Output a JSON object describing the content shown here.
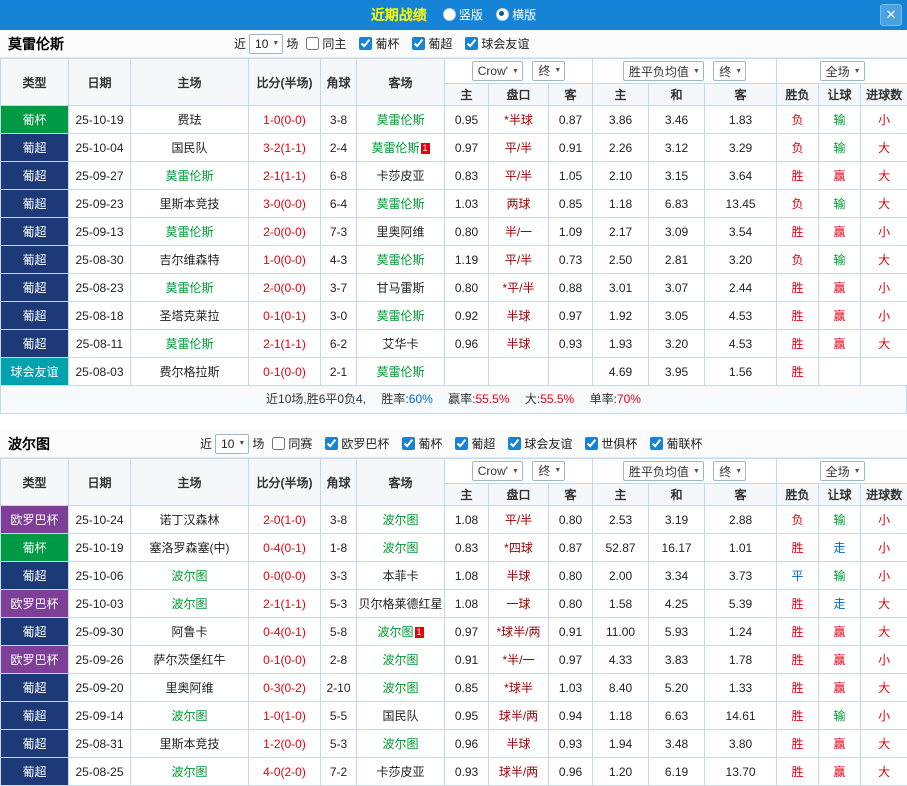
{
  "topbar": {
    "title": "近期战绩",
    "layout_options": [
      {
        "label": "竖版",
        "checked": false
      },
      {
        "label": "横版",
        "checked": true
      }
    ]
  },
  "icons": {
    "chevron_down": "▼",
    "close": "✕"
  },
  "colors": {
    "topbar_blue": "#1584d6",
    "title_yellow": "#ffff00",
    "cup_green": "#009a44",
    "liga_navy": "#1b3a77",
    "friendly_teal": "#00a2ad",
    "europa_purple": "#7d3f98",
    "score_red": "#e60012",
    "team_green": "#009933",
    "loss_green": "#009933",
    "win_red": "#e60012",
    "push_blue": "#0066cc"
  },
  "controls": {
    "near_label": "近",
    "count_value": "10",
    "matches_label": "场"
  },
  "header": {
    "type": "类型",
    "date": "日期",
    "home": "主场",
    "score": "比分(半场)",
    "corner": "角球",
    "away": "客场",
    "h_home": "主",
    "h_handicap": "盘口",
    "h_away": "客",
    "o_home": "主",
    "o_draw": "和",
    "o_away": "客",
    "res": "胜负",
    "let": "让球",
    "goals": "进球数",
    "bookmaker": "Crow'",
    "final1": "终",
    "avg": "胜平负均值",
    "final2": "终",
    "scope": "全场"
  },
  "sections": [
    {
      "team": "莫雷伦斯",
      "filters": [
        {
          "label": "同主",
          "checked": false
        },
        {
          "label": "葡杯",
          "checked": true
        },
        {
          "label": "葡超",
          "checked": true
        },
        {
          "label": "球会友谊",
          "checked": true
        }
      ],
      "rows": [
        {
          "type": "葡杯",
          "type_cls": "lg-cup",
          "date": "25-10-19",
          "home": "费珐",
          "score": "1-0(0-0)",
          "corner": "3-8",
          "away": "莫雷伦斯",
          "away_cls": "focus",
          "h_home": "0.95",
          "handicap": "*半球",
          "h_away": "0.87",
          "o_home": "3.86",
          "o_draw": "3.46",
          "o_away": "1.83",
          "res": "负",
          "res_cls": "t-red",
          "let": "输",
          "let_cls": "t-green",
          "goal": "小",
          "goal_cls": "t-red"
        },
        {
          "type": "葡超",
          "type_cls": "lg-liga",
          "date": "25-10-04",
          "home": "国民队",
          "score": "3-2(1-1)",
          "corner": "2-4",
          "away": "莫雷伦斯",
          "away_cls": "focus",
          "away_badge": "1",
          "h_home": "0.97",
          "handicap": "平/半",
          "h_away": "0.91",
          "o_home": "2.26",
          "o_draw": "3.12",
          "o_away": "3.29",
          "res": "负",
          "res_cls": "t-red",
          "let": "输",
          "let_cls": "t-green",
          "goal": "大",
          "goal_cls": "t-red"
        },
        {
          "type": "葡超",
          "type_cls": "lg-liga",
          "date": "25-09-27",
          "home": "莫雷伦斯",
          "home_cls": "focus",
          "score": "2-1(1-1)",
          "corner": "6-8",
          "away": "卡莎皮亚",
          "h_home": "0.83",
          "handicap": "平/半",
          "h_away": "1.05",
          "o_home": "2.10",
          "o_draw": "3.15",
          "o_away": "3.64",
          "res": "胜",
          "res_cls": "t-red",
          "let": "赢",
          "let_cls": "t-red",
          "goal": "大",
          "goal_cls": "t-red"
        },
        {
          "type": "葡超",
          "type_cls": "lg-liga",
          "date": "25-09-23",
          "home": "里斯本竞技",
          "score": "3-0(0-0)",
          "corner": "6-4",
          "away": "莫雷伦斯",
          "away_cls": "focus",
          "h_home": "1.03",
          "handicap": "两球",
          "h_away": "0.85",
          "o_home": "1.18",
          "o_draw": "6.83",
          "o_away": "13.45",
          "res": "负",
          "res_cls": "t-red",
          "let": "输",
          "let_cls": "t-green",
          "goal": "大",
          "goal_cls": "t-red"
        },
        {
          "type": "葡超",
          "type_cls": "lg-liga",
          "date": "25-09-13",
          "home": "莫雷伦斯",
          "home_cls": "focus",
          "score": "2-0(0-0)",
          "corner": "7-3",
          "away": "里奥阿维",
          "h_home": "0.80",
          "handicap": "半/一",
          "h_away": "1.09",
          "o_home": "2.17",
          "o_draw": "3.09",
          "o_away": "3.54",
          "res": "胜",
          "res_cls": "t-red",
          "let": "赢",
          "let_cls": "t-red",
          "goal": "小",
          "goal_cls": "t-red"
        },
        {
          "type": "葡超",
          "type_cls": "lg-liga",
          "date": "25-08-30",
          "home": "吉尔维森特",
          "score": "1-0(0-0)",
          "corner": "4-3",
          "away": "莫雷伦斯",
          "away_cls": "focus",
          "h_home": "1.19",
          "handicap": "平/半",
          "h_away": "0.73",
          "o_home": "2.50",
          "o_draw": "2.81",
          "o_away": "3.20",
          "res": "负",
          "res_cls": "t-red",
          "let": "输",
          "let_cls": "t-green",
          "goal": "大",
          "goal_cls": "t-red"
        },
        {
          "type": "葡超",
          "type_cls": "lg-liga",
          "date": "25-08-23",
          "home": "莫雷伦斯",
          "home_cls": "focus",
          "score": "2-0(0-0)",
          "corner": "3-7",
          "away": "甘马雷斯",
          "h_home": "0.80",
          "handicap": "*平/半",
          "h_away": "0.88",
          "o_home": "3.01",
          "o_draw": "3.07",
          "o_away": "2.44",
          "res": "胜",
          "res_cls": "t-red",
          "let": "赢",
          "let_cls": "t-red",
          "goal": "小",
          "goal_cls": "t-red"
        },
        {
          "type": "葡超",
          "type_cls": "lg-liga",
          "date": "25-08-18",
          "home": "圣塔克莱拉",
          "score": "0-1(0-1)",
          "corner": "3-0",
          "away": "莫雷伦斯",
          "away_cls": "focus",
          "h_home": "0.92",
          "handicap": "半球",
          "h_away": "0.97",
          "o_home": "1.92",
          "o_draw": "3.05",
          "o_away": "4.53",
          "res": "胜",
          "res_cls": "t-red",
          "let": "赢",
          "let_cls": "t-red",
          "goal": "小",
          "goal_cls": "t-red"
        },
        {
          "type": "葡超",
          "type_cls": "lg-liga",
          "date": "25-08-11",
          "home": "莫雷伦斯",
          "home_cls": "focus",
          "score": "2-1(1-1)",
          "corner": "6-2",
          "away": "艾华卡",
          "h_home": "0.96",
          "handicap": "半球",
          "h_away": "0.93",
          "o_home": "1.93",
          "o_draw": "3.20",
          "o_away": "4.53",
          "res": "胜",
          "res_cls": "t-red",
          "let": "赢",
          "let_cls": "t-red",
          "goal": "大",
          "goal_cls": "t-red"
        },
        {
          "type": "球会友谊",
          "type_cls": "lg-friendly",
          "date": "25-08-03",
          "home": "费尔格拉斯",
          "score": "0-1(0-0)",
          "corner": "2-1",
          "away": "莫雷伦斯",
          "away_cls": "focus",
          "h_home": "",
          "handicap": "",
          "h_away": "",
          "o_home": "4.69",
          "o_draw": "3.95",
          "o_away": "1.56",
          "res": "胜",
          "res_cls": "t-red",
          "let": "",
          "goal": ""
        }
      ],
      "summary": {
        "prefix": "近10场,胜6平0负4,",
        "stats": [
          {
            "label": "胜率:",
            "value": "60%",
            "cls": "t-blue"
          },
          {
            "label": "赢率:",
            "value": "55.5%",
            "cls": "t-red"
          },
          {
            "label": "大:",
            "value": "55.5%",
            "cls": "t-red"
          },
          {
            "label": "单率:",
            "value": "70%",
            "cls": "t-red"
          }
        ]
      }
    },
    {
      "team": "波尔图",
      "filters": [
        {
          "label": "同赛",
          "checked": false
        },
        {
          "label": "欧罗巴杯",
          "checked": true
        },
        {
          "label": "葡杯",
          "checked": true
        },
        {
          "label": "葡超",
          "checked": true
        },
        {
          "label": "球会友谊",
          "checked": true
        },
        {
          "label": "世俱杯",
          "checked": true
        },
        {
          "label": "葡联杯",
          "checked": true
        }
      ],
      "rows": [
        {
          "type": "欧罗巴杯",
          "type_cls": "lg-europa",
          "date": "25-10-24",
          "home": "诺丁汉森林",
          "score": "2-0(1-0)",
          "corner": "3-8",
          "away": "波尔图",
          "away_cls": "focus",
          "h_home": "1.08",
          "handicap": "平/半",
          "h_away": "0.80",
          "o_home": "2.53",
          "o_draw": "3.19",
          "o_away": "2.88",
          "res": "负",
          "res_cls": "t-red",
          "let": "输",
          "let_cls": "t-green",
          "goal": "小",
          "goal_cls": "t-red"
        },
        {
          "type": "葡杯",
          "type_cls": "lg-cup",
          "date": "25-10-19",
          "home": "塞洛罗森塞(中)",
          "score": "0-4(0-1)",
          "corner": "1-8",
          "away": "波尔图",
          "away_cls": "focus",
          "h_home": "0.83",
          "handicap": "*四球",
          "h_away": "0.87",
          "o_home": "52.87",
          "o_draw": "16.17",
          "o_away": "1.01",
          "res": "胜",
          "res_cls": "t-red",
          "let": "走",
          "let_cls": "t-blue",
          "goal": "小",
          "goal_cls": "t-red"
        },
        {
          "type": "葡超",
          "type_cls": "lg-liga",
          "date": "25-10-06",
          "home": "波尔图",
          "home_cls": "focus",
          "score": "0-0(0-0)",
          "corner": "3-3",
          "away": "本菲卡",
          "h_home": "1.08",
          "handicap": "半球",
          "h_away": "0.80",
          "o_home": "2.00",
          "o_draw": "3.34",
          "o_away": "3.73",
          "res": "平",
          "res_cls": "t-blue",
          "let": "输",
          "let_cls": "t-green",
          "goal": "小",
          "goal_cls": "t-red"
        },
        {
          "type": "欧罗巴杯",
          "type_cls": "lg-europa",
          "date": "25-10-03",
          "home": "波尔图",
          "home_cls": "focus",
          "score": "2-1(1-1)",
          "corner": "5-3",
          "away": "贝尔格莱德红星",
          "h_home": "1.08",
          "handicap": "一球",
          "h_away": "0.80",
          "o_home": "1.58",
          "o_draw": "4.25",
          "o_away": "5.39",
          "res": "胜",
          "res_cls": "t-red",
          "let": "走",
          "let_cls": "t-blue",
          "goal": "大",
          "goal_cls": "t-red"
        },
        {
          "type": "葡超",
          "type_cls": "lg-liga",
          "date": "25-09-30",
          "home": "阿鲁卡",
          "score": "0-4(0-1)",
          "corner": "5-8",
          "away": "波尔图",
          "away_cls": "focus",
          "away_badge": "1",
          "h_home": "0.97",
          "handicap": "*球半/两",
          "h_away": "0.91",
          "o_home": "11.00",
          "o_draw": "5.93",
          "o_away": "1.24",
          "res": "胜",
          "res_cls": "t-red",
          "let": "赢",
          "let_cls": "t-red",
          "goal": "大",
          "goal_cls": "t-red"
        },
        {
          "type": "欧罗巴杯",
          "type_cls": "lg-europa",
          "date": "25-09-26",
          "home": "萨尔茨堡红牛",
          "score": "0-1(0-0)",
          "corner": "2-8",
          "away": "波尔图",
          "away_cls": "focus",
          "h_home": "0.91",
          "handicap": "*半/一",
          "h_away": "0.97",
          "o_home": "4.33",
          "o_draw": "3.83",
          "o_away": "1.78",
          "res": "胜",
          "res_cls": "t-red",
          "let": "赢",
          "let_cls": "t-red",
          "goal": "小",
          "goal_cls": "t-red"
        },
        {
          "type": "葡超",
          "type_cls": "lg-liga",
          "date": "25-09-20",
          "home": "里奥阿维",
          "score": "0-3(0-2)",
          "corner": "2-10",
          "away": "波尔图",
          "away_cls": "focus",
          "h_home": "0.85",
          "handicap": "*球半",
          "h_away": "1.03",
          "o_home": "8.40",
          "o_draw": "5.20",
          "o_away": "1.33",
          "res": "胜",
          "res_cls": "t-red",
          "let": "赢",
          "let_cls": "t-red",
          "goal": "大",
          "goal_cls": "t-red"
        },
        {
          "type": "葡超",
          "type_cls": "lg-liga",
          "date": "25-09-14",
          "home": "波尔图",
          "home_cls": "focus",
          "score": "1-0(1-0)",
          "corner": "5-5",
          "away": "国民队",
          "h_home": "0.95",
          "handicap": "球半/两",
          "h_away": "0.94",
          "o_home": "1.18",
          "o_draw": "6.63",
          "o_away": "14.61",
          "res": "胜",
          "res_cls": "t-red",
          "let": "输",
          "let_cls": "t-green",
          "goal": "小",
          "goal_cls": "t-red"
        },
        {
          "type": "葡超",
          "type_cls": "lg-liga",
          "date": "25-08-31",
          "home": "里斯本竞技",
          "score": "1-2(0-0)",
          "corner": "5-3",
          "away": "波尔图",
          "away_cls": "focus",
          "h_home": "0.96",
          "handicap": "半球",
          "h_away": "0.93",
          "o_home": "1.94",
          "o_draw": "3.48",
          "o_away": "3.80",
          "res": "胜",
          "res_cls": "t-red",
          "let": "赢",
          "let_cls": "t-red",
          "goal": "大",
          "goal_cls": "t-red"
        },
        {
          "type": "葡超",
          "type_cls": "lg-liga",
          "date": "25-08-25",
          "home": "波尔图",
          "home_cls": "focus",
          "score": "4-0(2-0)",
          "corner": "7-2",
          "away": "卡莎皮亚",
          "h_home": "0.93",
          "handicap": "球半/两",
          "h_away": "0.96",
          "o_home": "1.20",
          "o_draw": "6.19",
          "o_away": "13.70",
          "res": "胜",
          "res_cls": "t-red",
          "let": "赢",
          "let_cls": "t-red",
          "goal": "大",
          "goal_cls": "t-red"
        }
      ]
    }
  ]
}
